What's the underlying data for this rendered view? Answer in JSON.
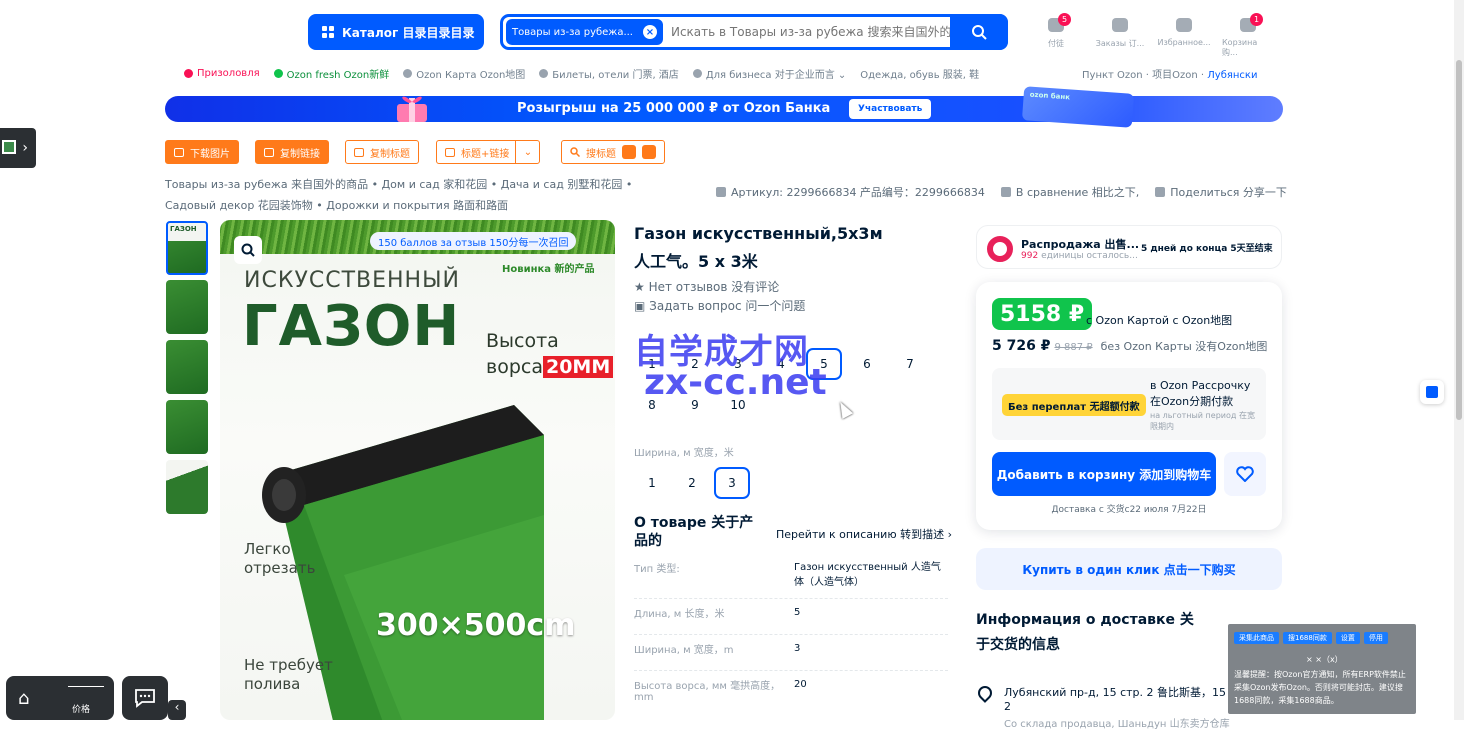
{
  "header": {
    "catalog_label": "Каталог 目录目录目录",
    "search_scope": "Товары из-за рубежа...",
    "search_placeholder": "Искать в Товары из-за рубежа 搜索来自国外的",
    "icons": [
      {
        "name": "orders-icon",
        "label": "付徒",
        "badge": "5"
      },
      {
        "name": "box-icon",
        "label": "Заказы 订...",
        "badge": ""
      },
      {
        "name": "heart-icon",
        "label": "Избранное...",
        "badge": ""
      },
      {
        "name": "cart-icon",
        "label": "Корзина 购...",
        "badge": "1"
      }
    ]
  },
  "nav": {
    "items": [
      {
        "label": "Призоловля",
        "color": "#f91155"
      },
      {
        "label": "Ozon fresh Ozon新鲜",
        "color": "#10c44c"
      },
      {
        "label": "Ozon Карта Ozon地图",
        "color": "#99a3ae"
      },
      {
        "label": "Билеты, отели 门票, 酒店",
        "color": "#99a3ae"
      },
      {
        "label": "Для бизнеса 对于企业而言 ⌄",
        "color": "#99a3ae"
      },
      {
        "label": "Одежда, обувь 服装, 鞋",
        "color": "#99a3ae"
      }
    ],
    "pickup_prefix": "Пункт Ozon · 项目Ozon ·",
    "pickup_place": "Лубянски"
  },
  "banner": {
    "text": "Розыгрыш на 25 000 000 ₽ от Ozon Банка",
    "button": "Участвовать",
    "card_label": "ozon банк"
  },
  "toolbar": {
    "download": "下载图片",
    "copy_link": "复制链接",
    "copy_title": "复制标题",
    "title_link": "标题+链接",
    "search_title": "搜标题"
  },
  "breadcrumb": {
    "items": [
      "Товары из-за рубежа 来自国外的商品",
      "Дом и сад 家和花园",
      "Дача и сад 别墅和花园",
      "Садовый декор 花园装饰物",
      "Дорожки и покрытия 路面和路面"
    ]
  },
  "meta": {
    "article": "Артикул: 2299666834 产品编号：2299666834",
    "compare": "В сравнение 相比之下,",
    "share": "Поделиться 分享一下"
  },
  "gallery": {
    "points": "150 баллов за отзыв 150分每一次召回",
    "new_tag": "Новинка 新的产品",
    "title1": "ИСКУССТВЕННЫЙ",
    "title2": "ГАЗОН",
    "height_label": "Высота",
    "pile_label": "ворса",
    "pile_value": "20MM",
    "size": "300×500cm",
    "feature1_l1": "Легко",
    "feature1_l2": "отрезать",
    "feature2_l1": "Не требует",
    "feature2_l2": "полива",
    "thumb_label": "ГАЗОН"
  },
  "product": {
    "title_line1": "Газон искусственный,5х3м",
    "title_line2": "人工气。5 x 3米",
    "reviews": "Нет отзывов 没有评论",
    "question": "Задать вопрос 问一个问题",
    "length_options": [
      "1",
      "2",
      "3",
      "4",
      "5",
      "6",
      "7",
      "8",
      "9",
      "10"
    ],
    "length_selected": "5",
    "width_label": "Ширина, м 宽度，米",
    "width_options": [
      "1",
      "2",
      "3"
    ],
    "width_selected": "3",
    "about_title": "О товаре 关于产品的",
    "about_link": "Перейти к описанию 转到描述 ›",
    "specs": [
      {
        "k": "Тип 类型:",
        "v": "Газон искусственный 人造气体（人造气体）"
      },
      {
        "k": "Длина, м 长度，米",
        "v": "5"
      },
      {
        "k": "Ширина, м 宽度，m",
        "v": "3"
      },
      {
        "k": "Высота ворса, мм 毫拱高度，mm",
        "v": "20"
      }
    ]
  },
  "watermark": {
    "line1": "自学成才网",
    "line2": "zx-cc.net"
  },
  "sale": {
    "title": "Распродажа 出售...",
    "left_count": "992",
    "left_text": "единицы осталось...",
    "days": "5 дней до конца 5天至结束"
  },
  "price": {
    "card_price": "5158 ₽",
    "card_label": "с Ozon Картой с Ozon地图",
    "regular": "5 726 ₽",
    "old": "9 887 ₽",
    "no_card": "без Ozon Карты 没有Ozon地图",
    "install_badge": "Без переплат 无超额付款",
    "install_title": "в Ozon Рассрочку 在Ozon分期付款",
    "install_sub": "на льготный период 在宽限期内",
    "cart_button": "Добавить в корзину 添加到购物车",
    "delivery": "Доставка с 交货c22 июля 7月22日"
  },
  "one_click": "Купить в один клик 点击一下购买",
  "delivery_info": {
    "title": "Информация о доставке 关于交货的信息",
    "address": "Лубянский пр-д, 15 стр. 2 鲁比斯基，15 页，2",
    "from": "Со склада продавца, Шаньдун 山东卖方仓库"
  },
  "popup": {
    "btn1": "采集此商品",
    "btn2": "搜1688同款",
    "btn3": "设置",
    "btn4": "停用",
    "close": "× ×（x）",
    "text": "温馨提醒：按Ozon官方通知，所有ERP软件禁止采集Ozon发布Ozon。否则将可能封店。建议搜1688同款，采集1688商品。"
  },
  "bottom": {
    "price_label": "价格"
  },
  "colors": {
    "accent": "#005bff",
    "orange": "#ff7a1a",
    "green": "#10c44c",
    "pink": "#f91155"
  }
}
